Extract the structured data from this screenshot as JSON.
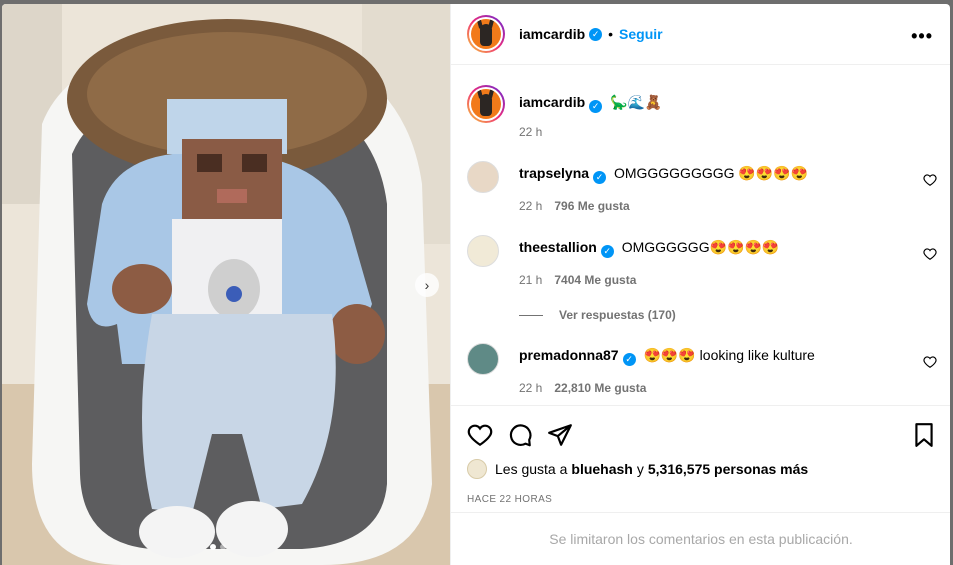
{
  "post": {
    "username": "iamcardib",
    "follow_label": "Seguir",
    "more_label": "•••",
    "caption_emojis": "🦕🌊🧸",
    "caption_time": "22 h"
  },
  "comments": [
    {
      "username": "trapselyna",
      "text": "OMGGGGGGGGG 😍😍😍😍",
      "time": "22 h",
      "likes": "796 Me gusta"
    },
    {
      "username": "theestallion",
      "text": "OMGGGGGG😍😍😍😍",
      "time": "21 h",
      "likes": "7404 Me gusta"
    },
    {
      "username": "premadonna87",
      "text": "😍😍😍 looking like kulture",
      "time": "22 h",
      "likes": "22,810 Me gusta"
    }
  ],
  "view_replies": "Ver respuestas (170)",
  "likes_line": {
    "prefix": "Les gusta a",
    "user": "bluehash",
    "connector": "y",
    "count": "5,316,575 personas más"
  },
  "posted_ago": "HACE 22 HORAS",
  "comments_limited": "Se limitaron los comentarios en esta publicación.",
  "icons": [
    "verified-badge-icon",
    "heart-icon",
    "comment-icon",
    "share-icon",
    "bookmark-icon",
    "chevron-right-icon"
  ],
  "colors": {
    "link": "#0095f6",
    "muted": "#737373",
    "border": "#efefef"
  }
}
